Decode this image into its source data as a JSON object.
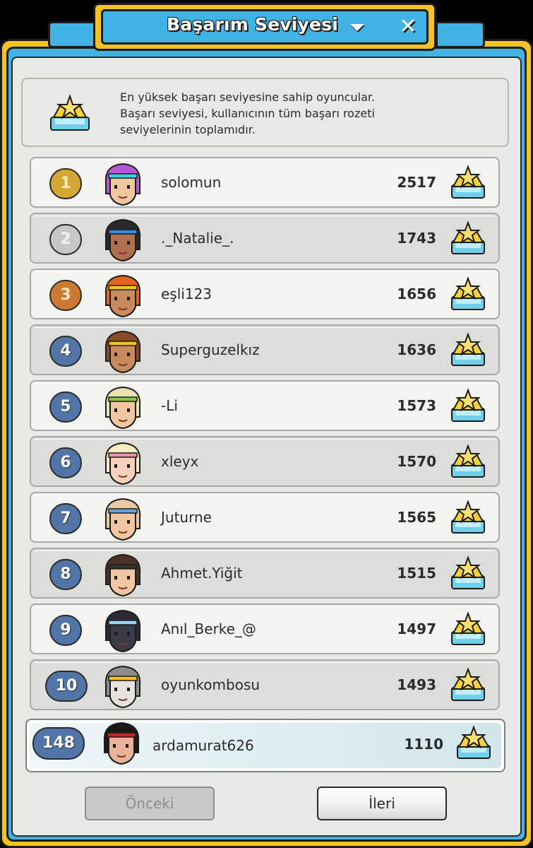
{
  "window": {
    "title": "Başarım Seviyesi",
    "close_symbol": "✕",
    "dropdown_icon": "chevron-down-icon",
    "close_icon": "close-icon"
  },
  "info": {
    "icon": "achievement-crown-icon",
    "lines": [
      "En yüksek başarı seviyesine sahip oyuncular.",
      "Başarı seviyesi, kullanıcının tüm başarı rozeti",
      "seviyelerinin toplamıdır."
    ]
  },
  "leaderboard": [
    {
      "rank": "1",
      "name": "solomun",
      "score": "2517",
      "medal": "gold"
    },
    {
      "rank": "2",
      "name": "._Natalie_.",
      "score": "1743",
      "medal": "silver"
    },
    {
      "rank": "3",
      "name": "eşli123",
      "score": "1656",
      "medal": "bronze"
    },
    {
      "rank": "4",
      "name": "Superguzelkız",
      "score": "1636",
      "medal": "blue"
    },
    {
      "rank": "5",
      "name": "-Li",
      "score": "1573",
      "medal": "blue"
    },
    {
      "rank": "6",
      "name": "xleyx",
      "score": "1570",
      "medal": "blue"
    },
    {
      "rank": "7",
      "name": "Juturne",
      "score": "1565",
      "medal": "blue"
    },
    {
      "rank": "8",
      "name": "Ahmet.Yiğit",
      "score": "1515",
      "medal": "blue"
    },
    {
      "rank": "9",
      "name": "Anıl_Berke_@",
      "score": "1497",
      "medal": "blue"
    },
    {
      "rank": "10",
      "name": "oyunkombosu",
      "score": "1493",
      "medal": "blue"
    }
  ],
  "current_user": {
    "rank": "148",
    "name": "ardamurat626",
    "score": "1110"
  },
  "pagination": {
    "prev_label": "Önceki",
    "next_label": "İleri",
    "prev_enabled": false,
    "next_enabled": true
  },
  "colors": {
    "frame_yellow": "#f2c321",
    "frame_blue": "#3fb4e4",
    "panel_bg": "#e9e9e6",
    "rank_blue": "#5275a8",
    "rank_gold": "#d4a634",
    "rank_silver": "#c7c7c7",
    "rank_bronze": "#cc7a32"
  },
  "avatar_palette": [
    {
      "hair": "#b657d6",
      "skin": "#f0c7a1",
      "accent": "#3ad1e6"
    },
    {
      "hair": "#2a2a2a",
      "skin": "#b07050",
      "accent": "#2f8ee0"
    },
    {
      "hair": "#e8631f",
      "skin": "#c98a5e",
      "accent": "#f2c321"
    },
    {
      "hair": "#8a4a25",
      "skin": "#c98a5e",
      "accent": "#f2c321"
    },
    {
      "hair": "#e9e2b0",
      "skin": "#f0c7a1",
      "accent": "#8bc34a"
    },
    {
      "hair": "#f5ecc0",
      "skin": "#f6d0bb",
      "accent": "#e88fb0"
    },
    {
      "hair": "#e8c9a3",
      "skin": "#f0c7a1",
      "accent": "#5fa8d8"
    },
    {
      "hair": "#4a3226",
      "skin": "#f0c7a1",
      "accent": "#333333"
    },
    {
      "hair": "#2b2b38",
      "skin": "#3b3b48",
      "accent": "#9fd4f0"
    },
    {
      "hair": "#8d8d8d",
      "skin": "#e8e3dc",
      "accent": "#f2c321"
    },
    {
      "hair": "#1a1a1a",
      "skin": "#e9b29a",
      "accent": "#c0282a"
    }
  ]
}
